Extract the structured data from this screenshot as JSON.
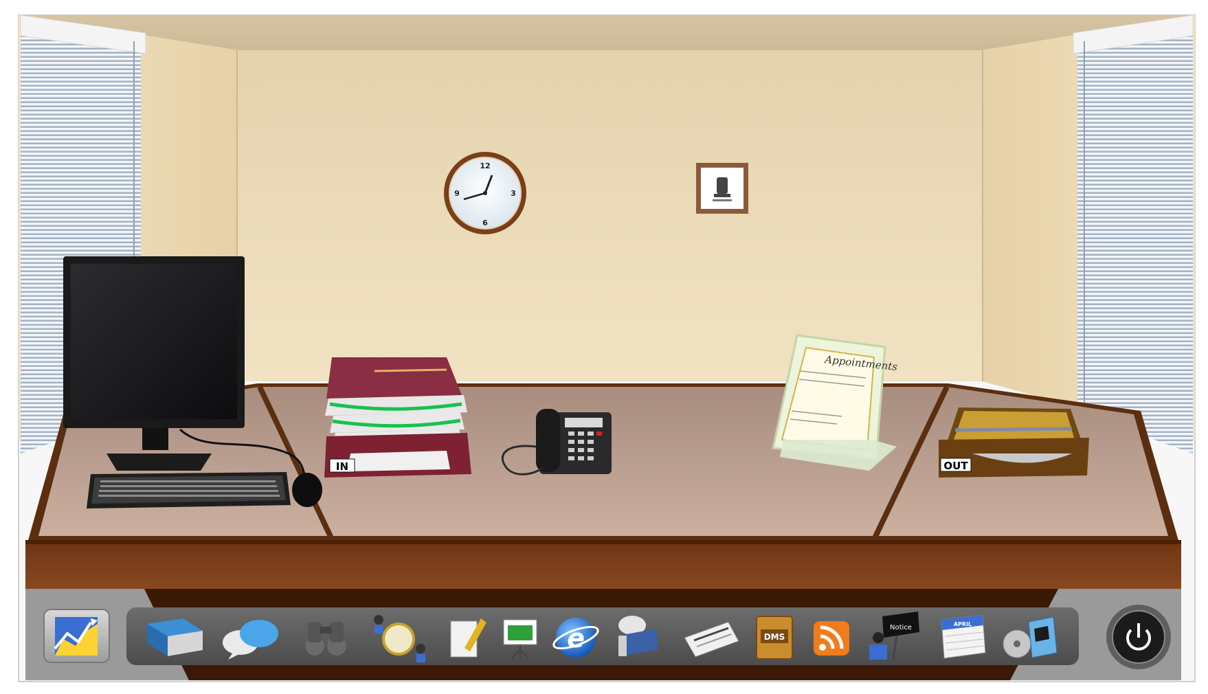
{
  "room": {
    "clock": {
      "numerals": [
        "12",
        "3",
        "6",
        "9"
      ]
    },
    "frame": {
      "icon": "national-emblem-icon"
    }
  },
  "desk": {
    "in_tray": {
      "label": "IN"
    },
    "out_tray": {
      "label": "OUT"
    },
    "appointments": {
      "title": "Appointments"
    }
  },
  "dock": {
    "left_button": {
      "icon": "chart-icon"
    },
    "items": [
      {
        "icon": "book-icon"
      },
      {
        "icon": "chat-bubbles-icon"
      },
      {
        "icon": "binoculars-icon"
      },
      {
        "icon": "contacts-exchange-icon"
      },
      {
        "icon": "notepad-icon"
      },
      {
        "icon": "presentation-board-icon"
      },
      {
        "icon": "internet-explorer-icon"
      },
      {
        "icon": "email-megaphone-icon"
      },
      {
        "icon": "newspaper-icon"
      },
      {
        "icon": "dms-folder-icon",
        "label": "DMS"
      },
      {
        "icon": "rss-feed-icon"
      },
      {
        "icon": "notice-board-icon",
        "label": "Notice"
      },
      {
        "icon": "calendar-icon",
        "label": "APRIL"
      },
      {
        "icon": "software-install-icon"
      }
    ],
    "power_button": {
      "icon": "power-icon"
    }
  },
  "colors": {
    "wall": "#e9d6ae",
    "desk_top": "#c4a897",
    "desk_front": "#7a3f1a",
    "dock_bg": "#5b5b5b"
  }
}
